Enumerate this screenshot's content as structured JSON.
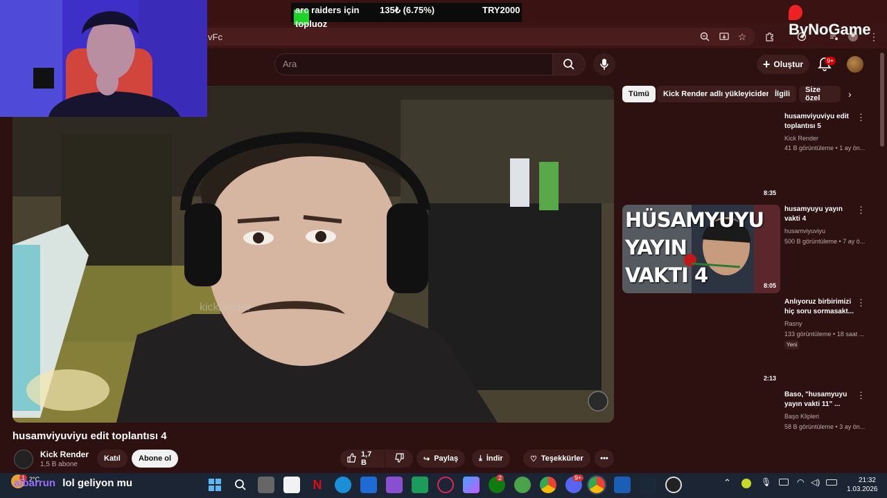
{
  "overlay": {
    "game": "arc raiders için topluız",
    "game_line1": "arc raiders için",
    "game_line2": "topluoz",
    "progress_text": "135₺ (6.75%)",
    "goal_text": "TRY2000",
    "brand": "ByNoGame"
  },
  "browser": {
    "url_fragment": "vFc"
  },
  "search": {
    "placeholder": "Ara"
  },
  "header": {
    "create_label": "Oluştur",
    "notif_count": "9+"
  },
  "video": {
    "watermark": "kickrender",
    "title": "husamviyuviyu edit toplantısı 4"
  },
  "channel": {
    "name": "Kick Render",
    "subs": "1,5 B abone",
    "join_label": "Katıl",
    "subscribe_label": "Abone ol"
  },
  "actions": {
    "likes": "1,7 B",
    "share": "Paylaş",
    "download": "İndir",
    "thanks": "Teşekkürler"
  },
  "chips": [
    "Tümü",
    "Kick Render adlı yükleyiciden",
    "İlgili",
    "Size özel"
  ],
  "sidebar": [
    {
      "title": "husamviyuviyu edit toplantısı 5",
      "channel": "Kick Render",
      "meta": "41 B görüntüleme • 1 ay ön...",
      "duration": "8:35"
    },
    {
      "title": "husamyuyu yayın vakti 4",
      "channel": "husamviyuviyu",
      "meta": "500 B görüntüleme • 7 ay ö...",
      "duration": "8:05",
      "thumb_text": "HÜSAMYUYU YAYIN VAKTI 4"
    },
    {
      "title": "Anlıyoruz birbirimizi hiç soru sormasakt...",
      "channel": "Rasny",
      "meta": "133 görüntüleme • 18 saat ...",
      "tag": "Yeni",
      "duration": "2:13"
    },
    {
      "title": "Baso, \"husamyuyu yayın vakti 11\" ...",
      "channel": "Başo Klipleri",
      "meta": "58 B görüntüleme • 3 ay ön..."
    }
  ],
  "chat": {
    "user": "aibarrun",
    "message": "lol geliyon mu"
  },
  "taskbar": {
    "weather": "2°C",
    "weather_badge": "1",
    "time": "21:32",
    "date": "1.03.2026",
    "xbox_badge": "2",
    "discord_badge": "9+"
  }
}
